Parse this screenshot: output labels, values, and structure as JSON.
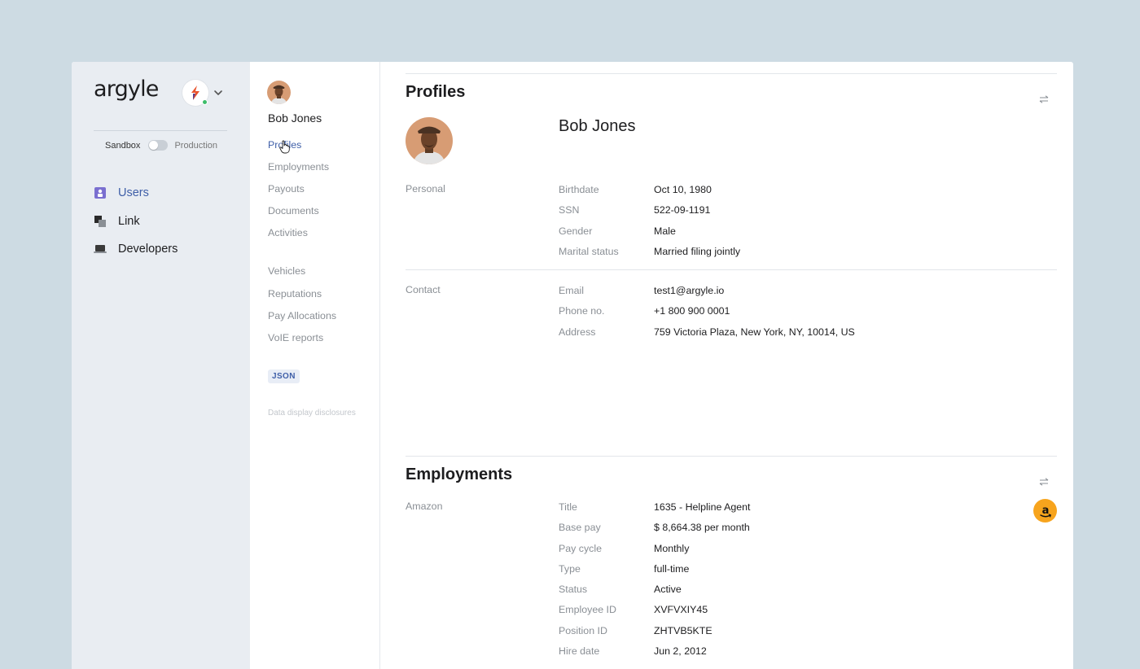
{
  "brand": {
    "logo": "argyle"
  },
  "environment": {
    "left": "Sandbox",
    "right": "Production"
  },
  "nav": [
    {
      "label": "Users",
      "icon": "user-icon",
      "active": true
    },
    {
      "label": "Link",
      "icon": "link-icon",
      "active": false
    },
    {
      "label": "Developers",
      "icon": "laptop-icon",
      "active": false
    }
  ],
  "user": {
    "name": "Bob Jones"
  },
  "subnav": {
    "group1": [
      "Profiles",
      "Employments",
      "Payouts",
      "Documents",
      "Activities"
    ],
    "group2": [
      "Vehicles",
      "Reputations",
      "Pay Allocations",
      "VoIE reports"
    ],
    "json_label": "JSON",
    "disclosure": "Data display disclosures"
  },
  "profiles": {
    "title": "Profiles",
    "name": "Bob Jones",
    "personal_label": "Personal",
    "personal": [
      {
        "k": "Birthdate",
        "v": "Oct 10, 1980"
      },
      {
        "k": "SSN",
        "v": "522-09-1191"
      },
      {
        "k": "Gender",
        "v": "Male"
      },
      {
        "k": "Marital status",
        "v": "Married filing jointly"
      }
    ],
    "contact_label": "Contact",
    "contact": [
      {
        "k": "Email",
        "v": "test1@argyle.io"
      },
      {
        "k": "Phone no.",
        "v": "+1 800 900 0001"
      },
      {
        "k": "Address",
        "v": "759 Victoria Plaza, New York, NY, 10014, US"
      }
    ]
  },
  "employments": {
    "title": "Employments",
    "employer": "Amazon",
    "fields": [
      {
        "k": "Title",
        "v": "1635 - Helpline Agent"
      },
      {
        "k": "Base pay",
        "v": "$ 8,664.38 per month"
      },
      {
        "k": "Pay cycle",
        "v": "Monthly"
      },
      {
        "k": "Type",
        "v": "full-time"
      },
      {
        "k": "Status",
        "v": "Active"
      },
      {
        "k": "Employee ID",
        "v": "XVFVXIY45"
      },
      {
        "k": "Position ID",
        "v": "ZHTVB5KTE"
      },
      {
        "k": "Hire date",
        "v": "Jun 2, 2012"
      }
    ]
  },
  "colors": {
    "accent": "#3f5fa8",
    "background": "#cddbe3",
    "sidebar": "#e9edf2",
    "amazon": "#f7a41d"
  }
}
